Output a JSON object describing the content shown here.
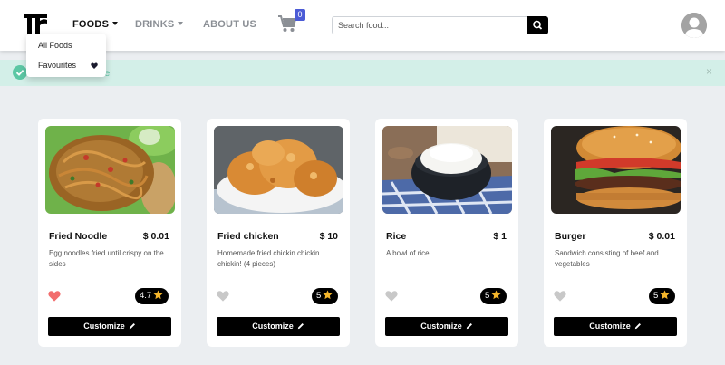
{
  "colors": {
    "accent": "#4b5bd6",
    "success": "#5cc7a4",
    "heart_active": "#f26d6d",
    "heart_inactive": "#c8c8c8",
    "star": "#f5b62b"
  },
  "nav": {
    "logo_icon": "logo-icon",
    "links": [
      {
        "label": "FOODS",
        "active": true
      },
      {
        "label": "DRINKS",
        "active": false
      },
      {
        "label": "ABOUT US",
        "active": false
      }
    ],
    "cart_count": "0",
    "search_placeholder": "Search food..."
  },
  "dropdown": {
    "items": [
      {
        "label": "All Foods"
      },
      {
        "label": "Favourites",
        "icon": "heart-icon"
      }
    ]
  },
  "alert": {
    "text": "Added to favourite",
    "close": "×"
  },
  "cards": [
    {
      "name": "Fried Noodle",
      "price": "$ 0.01",
      "description": "Egg noodles fried until crispy on the sides",
      "rating": "4.7",
      "favourite": true,
      "button": "Customize"
    },
    {
      "name": "Fried chicken",
      "price": "$ 10",
      "description": "Homemade fried chickin chickin chickin! (4 pieces)",
      "rating": "5",
      "favourite": false,
      "button": "Customize"
    },
    {
      "name": "Rice",
      "price": "$ 1",
      "description": "A bowl of rice.",
      "rating": "5",
      "favourite": false,
      "button": "Customize"
    },
    {
      "name": "Burger",
      "price": "$ 0.01",
      "description": "Sandwich consisting of beef and vegetables",
      "rating": "5",
      "favourite": false,
      "button": "Customize"
    }
  ]
}
